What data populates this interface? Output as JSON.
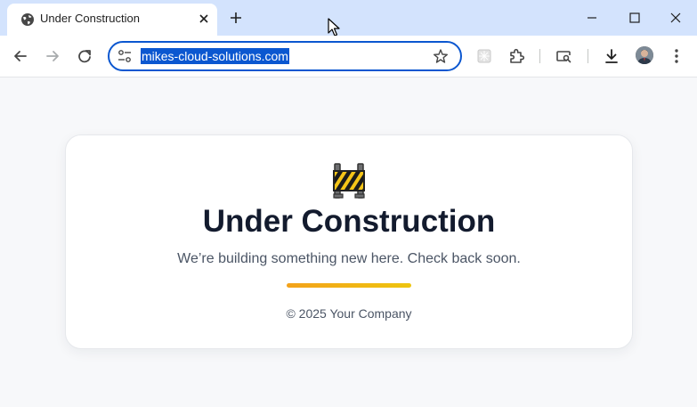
{
  "browser": {
    "tab": {
      "title": "Under Construction",
      "favicon": "globe-icon"
    },
    "address_bar": {
      "url": "mikes-cloud-solutions.com"
    },
    "toolbar_icons": [
      "back-icon",
      "forward-icon",
      "reload-icon",
      "site-settings-icon",
      "bookmark-star-icon",
      "extension-puzzle-icon",
      "tab-search-icon",
      "download-icon",
      "menu-icon"
    ],
    "accent_color": "#0b57d0"
  },
  "page": {
    "icon": "construction-barrier-icon",
    "heading": "Under Construction",
    "subtitle": "We’re building something new here. Check back soon.",
    "footer": "© 2025 Your Company",
    "accent_gradient": [
      "#f3a21b",
      "#eec50f"
    ]
  }
}
